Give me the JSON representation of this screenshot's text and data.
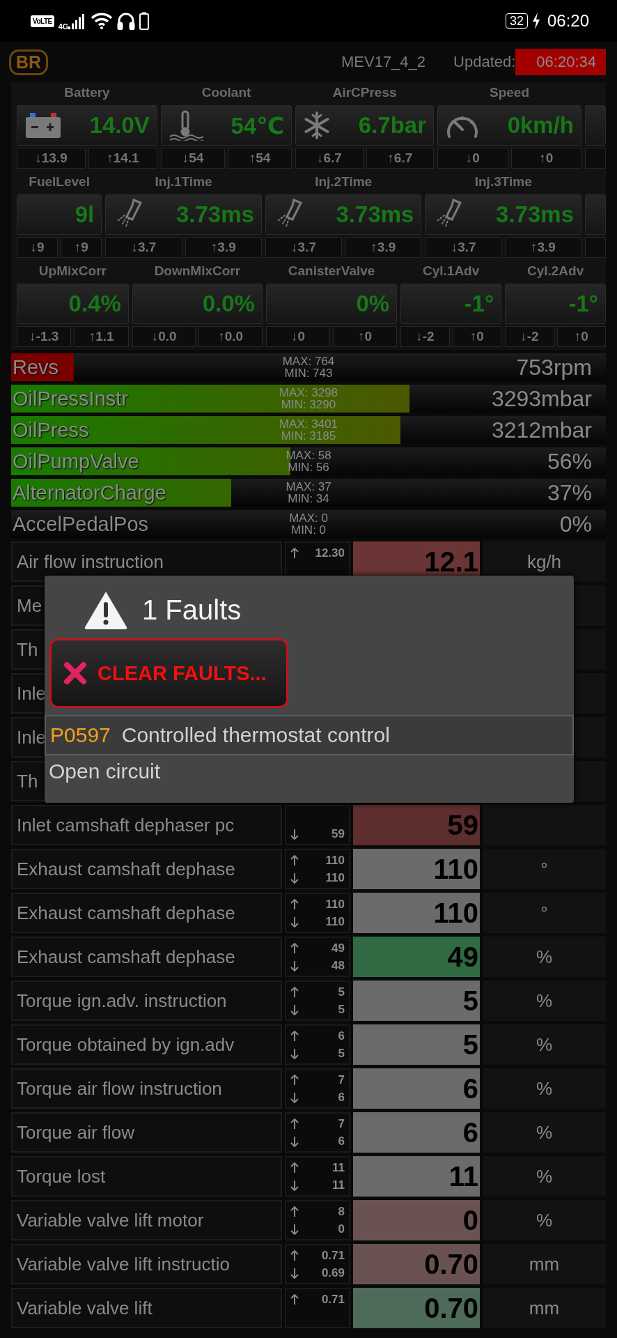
{
  "status_bar": {
    "network_badge": "VoLTE",
    "network_type": "4G",
    "battery": "32",
    "time": "06:20"
  },
  "header": {
    "badge": "BR",
    "ecu": "MEV17_4_2",
    "updated_label": "Updated:",
    "updated_time": "06:20:34"
  },
  "gauge_rows": [
    [
      {
        "kind": "battery",
        "label": "Battery",
        "value": "14.0V",
        "min": "↓13.9",
        "max": "↑14.1"
      },
      {
        "kind": "thermometer",
        "label": "Coolant",
        "value": "54℃",
        "min": "↓54",
        "max": "↑54"
      },
      {
        "kind": "snowflake",
        "label": "AirCPress",
        "value": "6.7bar",
        "min": "↓6.7",
        "max": "↑6.7"
      },
      {
        "kind": "speedometer",
        "label": "Speed",
        "value": "0km/h",
        "min": "↓0",
        "max": "↑0"
      },
      {
        "kind": "partial"
      }
    ],
    [
      {
        "kind": "plain",
        "label": "FuelLevel",
        "value": "9l",
        "min": "↓9",
        "max": "↑9"
      },
      {
        "kind": "injector",
        "label": "Inj.1Time",
        "value": "3.73ms",
        "min": "↓3.7",
        "max": "↑3.9"
      },
      {
        "kind": "injector",
        "label": "Inj.2Time",
        "value": "3.73ms",
        "min": "↓3.7",
        "max": "↑3.9"
      },
      {
        "kind": "injector",
        "label": "Inj.3Time",
        "value": "3.73ms",
        "min": "↓3.7",
        "max": "↑3.9"
      },
      {
        "kind": "partial"
      }
    ],
    [
      {
        "kind": "plain",
        "label": "UpMixCorr",
        "value": "0.4%",
        "min": "↓-1.3",
        "max": "↑1.1"
      },
      {
        "kind": "plain",
        "label": "DownMixCorr",
        "value": "0.0%",
        "min": "↓0.0",
        "max": "↑0.0"
      },
      {
        "kind": "plain",
        "label": "CanisterValve",
        "value": "0%",
        "min": "↓0",
        "max": "↑0"
      },
      {
        "kind": "plain",
        "label": "Cyl.1Adv",
        "value": "-1°",
        "min": "↓-2",
        "max": "↑0"
      },
      {
        "kind": "plain",
        "label": "Cyl.2Adv",
        "value": "-1°",
        "min": "↓-2",
        "max": "↑0"
      }
    ]
  ],
  "bars": [
    {
      "label": "Revs",
      "max": "MAX: 764",
      "min": "MIN: 743",
      "value": "753rpm",
      "level": 0.105,
      "kind": "alarm"
    },
    {
      "label": "OilPressInstr",
      "max": "MAX: 3298",
      "min": "MIN: 3290",
      "value": "3293mbar",
      "level": 0.67,
      "kind": "normal"
    },
    {
      "label": "OilPress",
      "max": "MAX: 3401",
      "min": "MIN: 3185",
      "value": "3212mbar",
      "level": 0.655,
      "kind": "normal"
    },
    {
      "label": "OilPumpValve",
      "max": "MAX: 58",
      "min": "MIN: 56",
      "value": "56%",
      "level": 0.47,
      "kind": "normal"
    },
    {
      "label": "AlternatorCharge",
      "max": "MAX: 37",
      "min": "MIN: 34",
      "value": "37%",
      "level": 0.37,
      "kind": "normal"
    },
    {
      "label": "AccelPedalPos",
      "max": "MAX: 0",
      "min": "MIN: 0",
      "value": "0%",
      "level": 0,
      "kind": "normal"
    }
  ],
  "table": {
    "rows": [
      {
        "name": "Air flow instruction",
        "max": "12.30",
        "value": "12.1",
        "unit": "kg/h",
        "color": "#6b3535"
      },
      {
        "name": "Me"
      },
      {
        "name": "Th"
      },
      {
        "name": "Inle"
      },
      {
        "name": "Inle"
      },
      {
        "name": "Th"
      },
      {
        "name": "Inlet camshaft dephaser pc",
        "min": "59",
        "value": "59",
        "color": "#5e2d2d"
      },
      {
        "name": "Exhaust camshaft dephase",
        "max": "110",
        "min": "110",
        "value": "110",
        "unit": "°",
        "color": "#6b6b6b"
      },
      {
        "name": "Exhaust camshaft dephase",
        "max": "110",
        "min": "110",
        "value": "110",
        "unit": "°",
        "color": "#6b6b6b"
      },
      {
        "name": "Exhaust camshaft dephase",
        "max": "49",
        "min": "48",
        "value": "49",
        "unit": "%",
        "color": "#2f6a42"
      },
      {
        "name": "Torque ign.adv. instruction",
        "max": "5",
        "min": "5",
        "value": "5",
        "unit": "%",
        "color": "#6b6b6b"
      },
      {
        "name": "Torque obtained by ign.adv",
        "max": "6",
        "min": "5",
        "value": "5",
        "unit": "%",
        "color": "#6b6b6b"
      },
      {
        "name": "Torque air flow instruction",
        "max": "7",
        "min": "6",
        "value": "6",
        "unit": "%",
        "color": "#6b6b6b"
      },
      {
        "name": "Torque air flow",
        "max": "7",
        "min": "6",
        "value": "6",
        "unit": "%",
        "color": "#6b6b6b"
      },
      {
        "name": "Torque lost",
        "max": "11",
        "min": "11",
        "value": "11",
        "unit": "%",
        "color": "#6b6b6b"
      },
      {
        "name": "Variable valve lift motor",
        "max": "8",
        "min": "0",
        "value": "0",
        "unit": "%",
        "color": "#6b5252"
      },
      {
        "name": "Variable valve lift instructio",
        "max": "0.71",
        "min": "0.69",
        "value": "0.70",
        "unit": "mm",
        "color": "#6b5252"
      },
      {
        "name": "Variable valve lift",
        "max": "0.71",
        "value": "0.70",
        "unit": "mm",
        "color": "#4e6a58"
      }
    ]
  },
  "dialog": {
    "title": "1 Faults",
    "button": "CLEAR FAULTS...",
    "faults": [
      {
        "code": "P0597",
        "description": "Controlled thermostat control",
        "detail": "Open circuit"
      }
    ]
  }
}
